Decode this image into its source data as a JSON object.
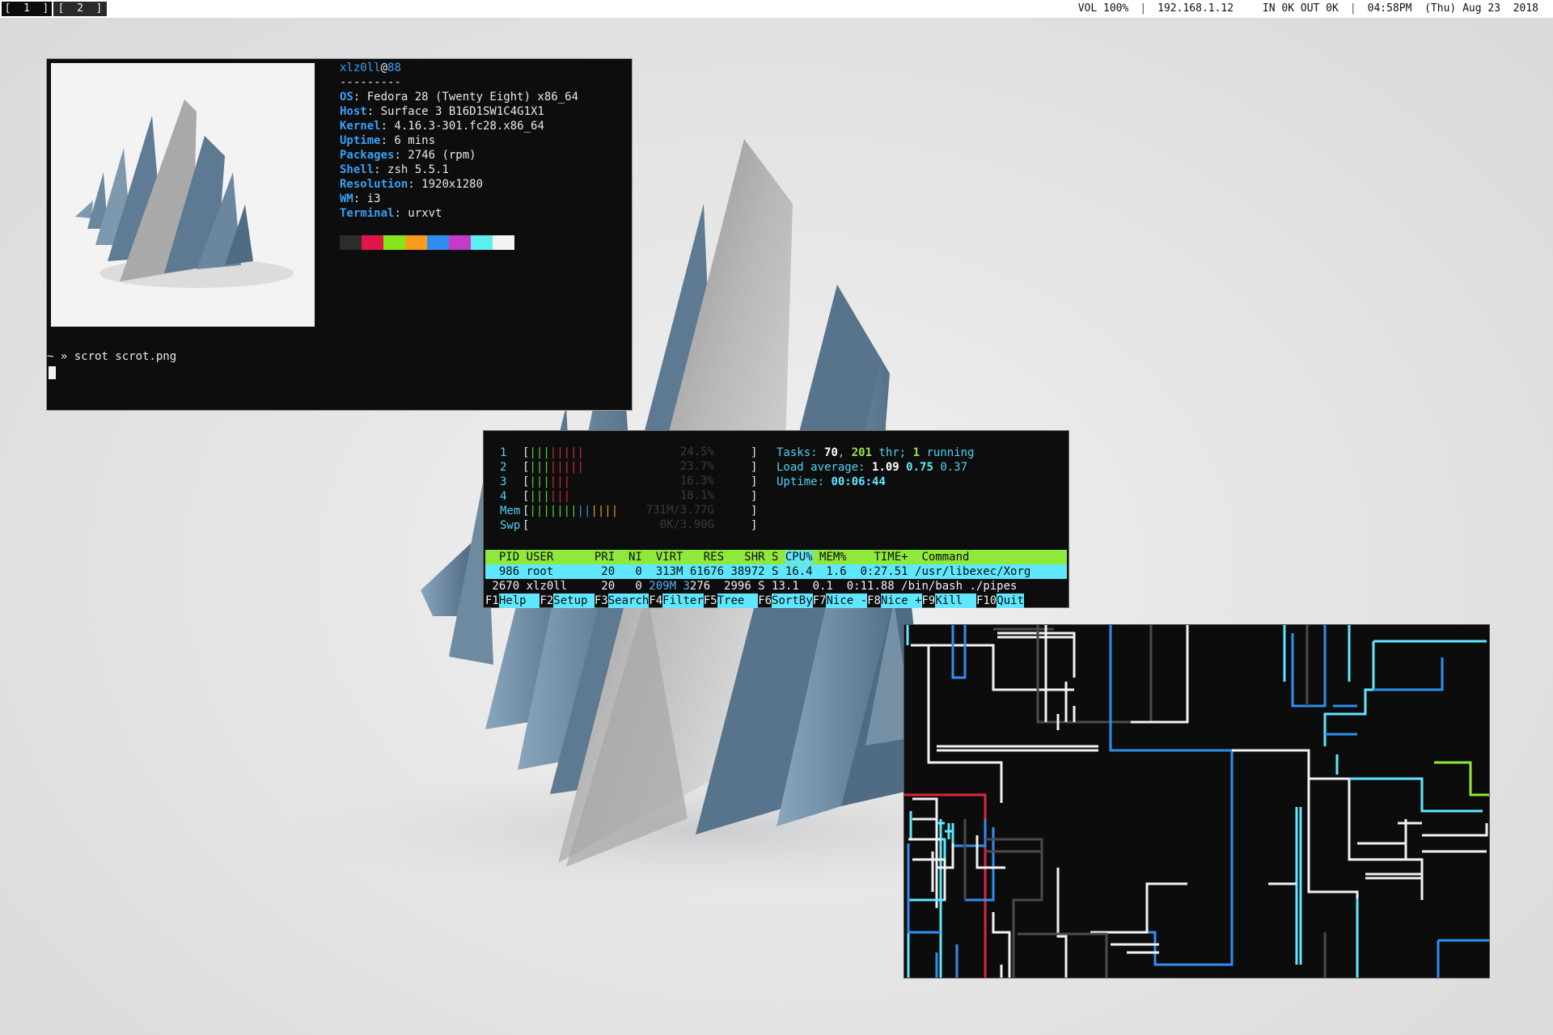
{
  "topbar": {
    "workspaces": [
      "[  1  ]",
      "[  2  ]"
    ],
    "volume": "VOL 100%",
    "ip": "192.168.1.12",
    "net": "IN 0K OUT 0K",
    "time": "04:58PM",
    "date": "(Thu) Aug 23  2018"
  },
  "neofetch": {
    "user": "xlz0ll",
    "at": "@",
    "host": "88",
    "separator": "---------",
    "rows": [
      {
        "label": "OS",
        "value": ": Fedora 28 (Twenty Eight) x86_64"
      },
      {
        "label": "Host",
        "value": ": Surface 3 B16D1SW1C4G1X1"
      },
      {
        "label": "Kernel",
        "value": ": 4.16.3-301.fc28.x86_64"
      },
      {
        "label": "Uptime",
        "value": ": 6 mins"
      },
      {
        "label": "Packages",
        "value": ": 2746 (rpm)"
      },
      {
        "label": "Shell",
        "value": ": zsh 5.5.1"
      },
      {
        "label": "Resolution",
        "value": ": 1920x1280"
      },
      {
        "label": "WM",
        "value": ": i3"
      },
      {
        "label": "Terminal",
        "value": ": urxvt"
      }
    ],
    "palette": [
      "#2c2c2c",
      "#e0164a",
      "#86e51a",
      "#f59d1b",
      "#2f8cf3",
      "#c53ac8",
      "#5ef0f0",
      "#f3f3f3"
    ],
    "prompt": "~ » scrot scrot.png"
  },
  "htop": {
    "meters": [
      {
        "label": "1",
        "bar": "||||||||",
        "pct": "24.5%"
      },
      {
        "label": "2",
        "bar": "||||||||",
        "pct": "23.7%"
      },
      {
        "label": "3",
        "bar": "||||||",
        "pct": "16.3%"
      },
      {
        "label": "4",
        "bar": "||||||",
        "pct": "18.1%"
      },
      {
        "label": "Mem",
        "bar": "|||||||||||||",
        "pct": "731M/3.77G"
      },
      {
        "label": "Swp",
        "bar": "",
        "pct": "0K/3.90G"
      }
    ],
    "tasks_label": "Tasks: ",
    "tasks": "70",
    "thr": "201",
    "thr_label": " thr; ",
    "running": "1",
    "running_label": " running",
    "load_label": "Load average: ",
    "load1": "1.09",
    "load5": "0.75",
    "load15": "0.37",
    "uptime_label": "Uptime: ",
    "uptime": "00:06:44",
    "header": "  PID USER      PRI  NI  VIRT   RES   SHR S ",
    "header_cpu": "CPU%",
    "header_rest": " MEM%    TIME+  Command",
    "processes": [
      {
        "pre": "  986 root       20   0  313M 61676 38972 S 16.4  1.6  0:27.51 /usr/libexec/Xorg"
      },
      {
        "pre": " 2670 xlz0ll     20   0 ",
        "virt": "209M",
        "mid": " ",
        "res_hi": "3",
        "post": "276  2996 S 13.1  0.1  0:11.88 /bin/bash ./pipes"
      }
    ],
    "fkeys": [
      {
        "key": "F1",
        "label": "Help  "
      },
      {
        "key": "F2",
        "label": "Setup "
      },
      {
        "key": "F3",
        "label": "Search"
      },
      {
        "key": "F4",
        "label": "Filter"
      },
      {
        "key": "F5",
        "label": "Tree  "
      },
      {
        "key": "F6",
        "label": "SortBy"
      },
      {
        "key": "F7",
        "label": "Nice -"
      },
      {
        "key": "F8",
        "label": "Nice +"
      },
      {
        "key": "F9",
        "label": "Kill  "
      },
      {
        "key": "F10",
        "label": "Quit"
      }
    ]
  },
  "colors": {
    "pipe_white": "#f2f2f2",
    "pipe_blue": "#2f8ef0",
    "pipe_cyan": "#5ee7ff",
    "pipe_gray": "#4a4a4a",
    "pipe_red": "#e0243c",
    "pipe_green": "#8fe93a"
  }
}
